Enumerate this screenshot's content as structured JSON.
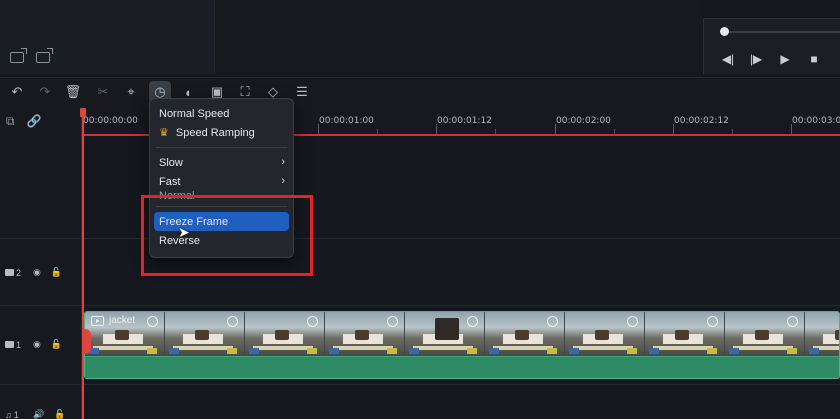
{
  "colors": {
    "accent_selected": "#1f5fc1",
    "playhead": "#e0453d",
    "highlight": "#e0242a",
    "clip_border": "#43b68f"
  },
  "library": {
    "icons": [
      "add-folder-icon",
      "folder-icon"
    ]
  },
  "player": {
    "buttons": [
      "step-back-icon",
      "step-forward-icon",
      "play-icon",
      "stop-icon"
    ]
  },
  "toolbar": {
    "tools": [
      "undo-icon",
      "redo-icon",
      "delete-icon",
      "cut-icon",
      "crop-icon",
      "speed-icon",
      "color-icon",
      "export-frame-icon",
      "auto-reframe-icon",
      "keyframe-icon",
      "adjust-icon"
    ]
  },
  "timeline": {
    "time_labels": [
      "00:00:00:00",
      "00:00:01:00",
      "00:00:01:12",
      "00:00:02:00",
      "00:00:02:12",
      "00:00:03:0"
    ],
    "tracks": [
      {
        "number": "2"
      },
      {
        "number": "1"
      },
      {
        "number": "1"
      }
    ],
    "clip": {
      "name": "jacket"
    }
  },
  "speed_menu": {
    "items": {
      "normal_speed": "Normal Speed",
      "speed_ramping": "Speed Ramping",
      "slow": "Slow",
      "fast": "Fast",
      "normal": "Normal",
      "freeze_frame": "Freeze Frame",
      "reverse": "Reverse"
    }
  }
}
